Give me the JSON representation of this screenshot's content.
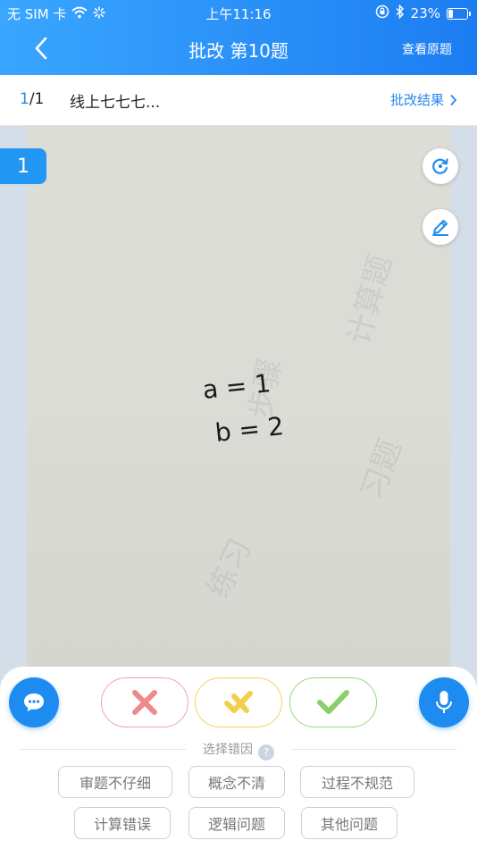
{
  "status": {
    "carrier": "无 SIM 卡",
    "time": "上午11:16",
    "battery": "23%"
  },
  "nav": {
    "title": "批改 第10题",
    "view_original": "查看原题"
  },
  "subbar": {
    "current": "1",
    "total": "/1",
    "name": "线上七七七...",
    "result": "批改结果"
  },
  "photo": {
    "badge": "1",
    "line1": "a = 1",
    "line2": "b = 2"
  },
  "reasons": {
    "label": "选择错因",
    "help": "?",
    "tags": [
      "审题不仔细",
      "概念不清",
      "过程不规范",
      "计算错误",
      "逻辑问题",
      "其他问题"
    ]
  },
  "colors": {
    "brand": "#1e8bf0",
    "wrong": "#f08a8a",
    "partial": "#f2cf4d",
    "correct": "#88d06a"
  }
}
